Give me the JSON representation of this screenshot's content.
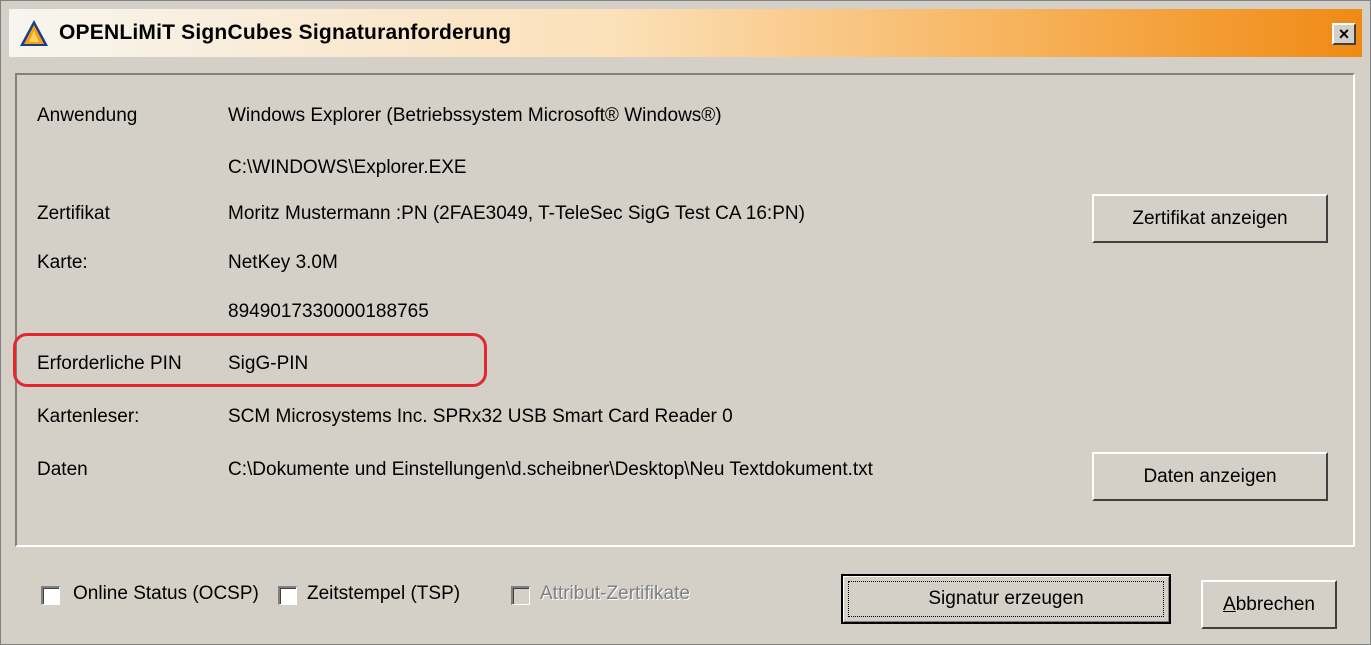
{
  "window": {
    "title": "OPENLiMiT SignCubes Signaturanforderung",
    "close_label": "×"
  },
  "fields": {
    "anwendung_label": "Anwendung",
    "anwendung_value": "Windows Explorer (Betriebssystem Microsoft® Windows®)",
    "anwendung_path": "C:\\WINDOWS\\Explorer.EXE",
    "zertifikat_label": "Zertifikat",
    "zertifikat_value": "Moritz Mustermann :PN (2FAE3049, T-TeleSec SigG Test CA 16:PN)",
    "karte_label": "Karte:",
    "karte_value": "NetKey 3.0M",
    "karte_number": "8949017330000188765",
    "pin_label": "Erforderliche PIN",
    "pin_value": "SigG-PIN",
    "kartenleser_label": "Kartenleser:",
    "kartenleser_value": "SCM Microsystems Inc. SPRx32 USB Smart Card Reader 0",
    "daten_label": "Daten",
    "daten_value": "C:\\Dokumente und Einstellungen\\d.scheibner\\Desktop\\Neu Textdokument.txt"
  },
  "buttons": {
    "zertifikat_anzeigen": "Zertifikat anzeigen",
    "daten_anzeigen": "Daten anzeigen",
    "signatur_erzeugen": "Signatur erzeugen",
    "abbrechen": "Abbrechen"
  },
  "options": {
    "ocsp": {
      "label": "Online Status (OCSP)",
      "checked": false,
      "enabled": true
    },
    "tsp": {
      "label": "Zeitstempel (TSP)",
      "checked": false,
      "enabled": true
    },
    "attribut": {
      "label": "Attribut-Zertifikate",
      "checked": false,
      "enabled": false
    }
  },
  "colors": {
    "title_gradient_end": "#f08a14",
    "highlight": "#e0282e",
    "dialog_bg": "#d4d0c8"
  }
}
